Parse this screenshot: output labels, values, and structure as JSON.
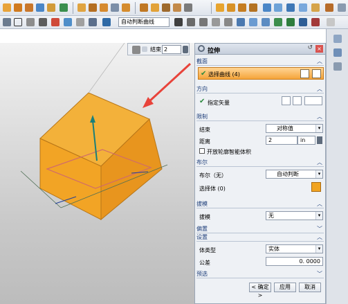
{
  "toolbar": {
    "selection_filter": "自动判断曲线"
  },
  "mini_toolbar": {
    "end_label": "结束",
    "end_value": "2"
  },
  "dialog": {
    "title": "拉伸",
    "sections": {
      "section": {
        "header": "截面",
        "select_curve": "选择曲线 (4)"
      },
      "direction": {
        "header": "方向",
        "specify_vector": "指定矢量"
      },
      "limits": {
        "header": "限制",
        "end_label": "结束",
        "end_value": "对称值",
        "distance_label": "距离",
        "distance_value": "2",
        "distance_unit": "in",
        "open_profile": "开放轮廓智能体积"
      },
      "boolean": {
        "header": "布尔",
        "bool_label": "布尔（无）",
        "bool_value": "自动判断",
        "select_body": "选择体 (0)"
      },
      "draft": {
        "header": "拔模",
        "draft_label": "拔模",
        "draft_value": "无"
      },
      "offset": {
        "header": "偏置"
      },
      "settings": {
        "header": "设置",
        "body_type_label": "体类型",
        "body_type_value": "实体",
        "tolerance_label": "公差",
        "tolerance_value": "0. 0000"
      },
      "preview": {
        "header": "预选"
      }
    },
    "buttons": {
      "ok": "< 确定 >",
      "apply": "应用",
      "cancel": "取消"
    }
  },
  "colors": {
    "accent_orange": "#f5a43a",
    "solid_fill": "#f1a422",
    "arrow_red": "#e8433a"
  }
}
